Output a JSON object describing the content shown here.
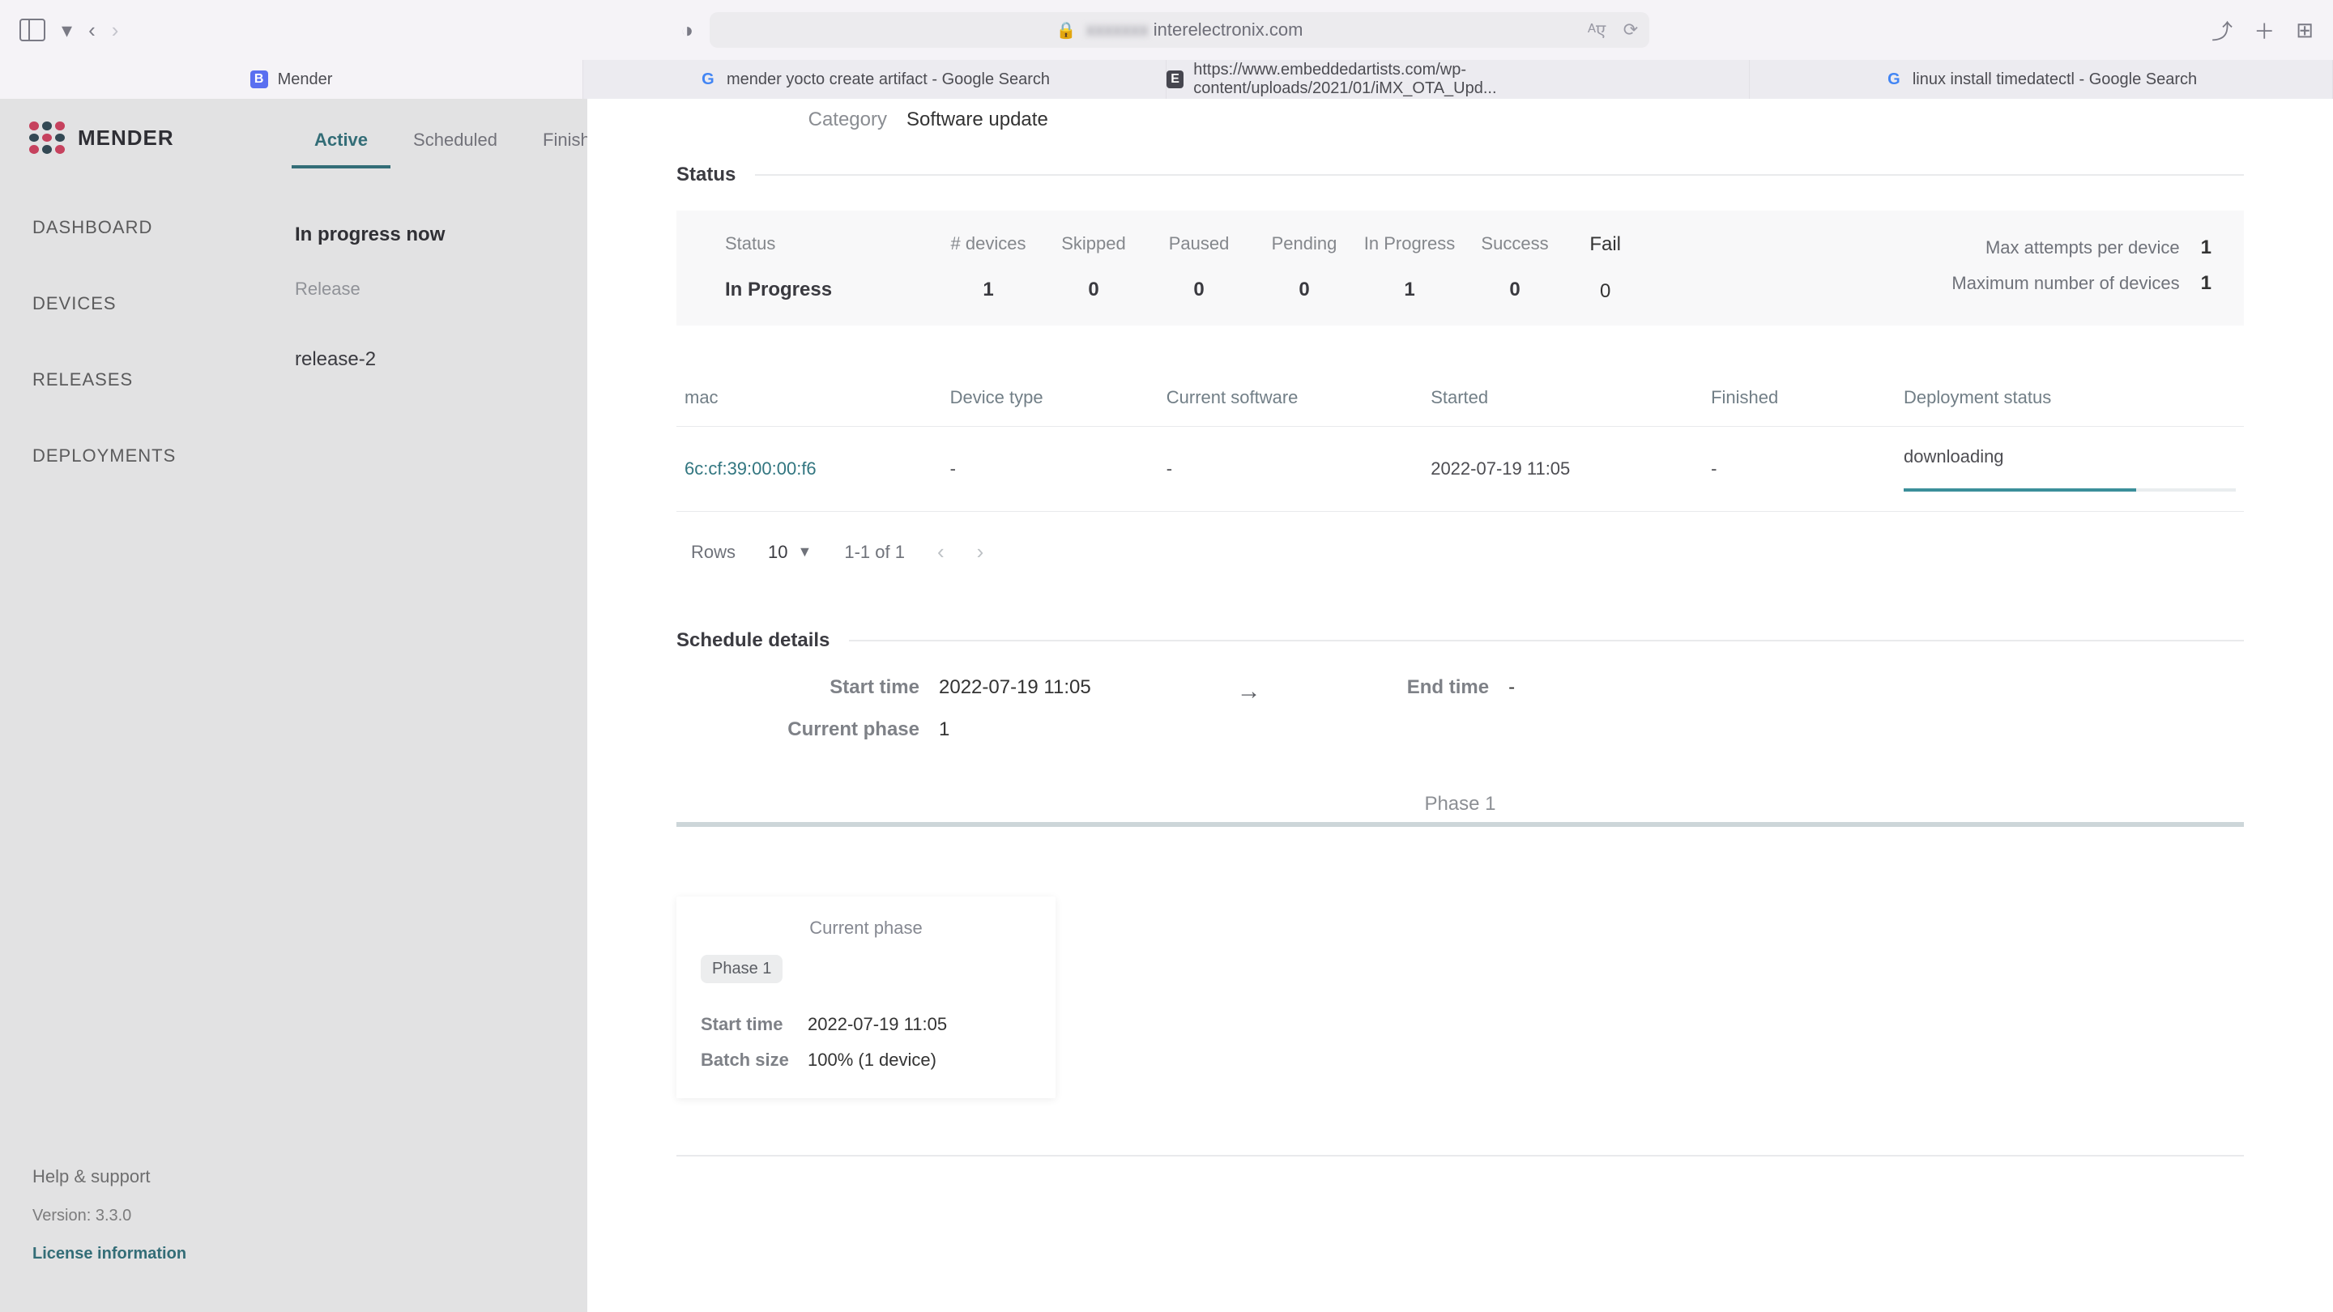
{
  "browser": {
    "url_blurred": "xxxxxxx",
    "url_visible": "interelectronix.com"
  },
  "tabs": [
    {
      "label": "Mender"
    },
    {
      "label": "mender yocto create artifact - Google Search"
    },
    {
      "label": "https://www.embeddedartists.com/wp-content/uploads/2021/01/iMX_OTA_Upd..."
    },
    {
      "label": "linux install timedatectl - Google Search"
    }
  ],
  "sidebar": {
    "brand": "MENDER",
    "items": [
      {
        "label": "DASHBOARD"
      },
      {
        "label": "DEVICES"
      },
      {
        "label": "RELEASES"
      },
      {
        "label": "DEPLOYMENTS"
      }
    ],
    "help": "Help & support",
    "version": "Version: 3.3.0",
    "license": "License information"
  },
  "deployments": {
    "tabs": {
      "active": "Active",
      "scheduled": "Scheduled",
      "finished": "Finished"
    },
    "now_header": "In progress now",
    "release_label": "Release",
    "release_value": "release-2"
  },
  "drawer": {
    "category_label": "Category",
    "category_value": "Software update",
    "status_header": "Status",
    "status": {
      "status_label": "Status",
      "devices_label": "# devices",
      "skipped_label": "Skipped",
      "paused_label": "Paused",
      "pending_label": "Pending",
      "inprogress_label": "In Progress",
      "success_label": "Success",
      "fail_label": "Fail",
      "status_value": "In Progress",
      "devices": "1",
      "skipped": "0",
      "paused": "0",
      "pending": "0",
      "inprogress": "1",
      "success": "0",
      "fail": "0",
      "max_attempts_label": "Max attempts per device",
      "max_attempts_value": "1",
      "max_devices_label": "Maximum number of devices",
      "max_devices_value": "1"
    },
    "table": {
      "headers": {
        "mac": "mac",
        "device_type": "Device type",
        "current_sw": "Current software",
        "started": "Started",
        "finished": "Finished",
        "dep_status": "Deployment status"
      },
      "row": {
        "mac": "6c:cf:39:00:00:f6",
        "device_type": "-",
        "current_sw": "-",
        "started": "2022-07-19 11:05",
        "finished": "-",
        "dep_status": "downloading"
      },
      "rows_label": "Rows",
      "rows_value": "10",
      "page_text": "1-1 of 1"
    },
    "schedule_header": "Schedule details",
    "schedule": {
      "start_label": "Start time",
      "start_value": "2022-07-19 11:05",
      "end_label": "End time",
      "end_value": "-",
      "phase_label": "Current phase",
      "phase_value": "1"
    },
    "phase_title": "Phase 1",
    "phase_card": {
      "title": "Current phase",
      "pill": "Phase 1",
      "start_label": "Start time",
      "start_value": "2022-07-19 11:05",
      "batch_label": "Batch size",
      "batch_value": "100% (1 device)"
    }
  }
}
